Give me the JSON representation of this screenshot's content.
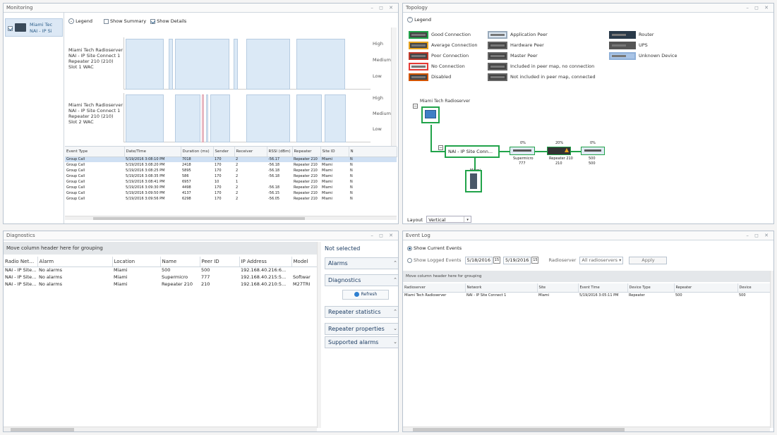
{
  "colors": {
    "accent": "#2d5f8a",
    "good": "#21a34a",
    "average": "#e7a21e",
    "poor": "#c0392b",
    "none": "#e53935",
    "disabled": "#d35400",
    "bar": "#dbe9f6"
  },
  "monitoring": {
    "title": "Monitoring",
    "device": {
      "name": "Miami Tec",
      "sub": "NAI - IP Si"
    },
    "legend": "Legend",
    "show_summary": "Show Summary",
    "show_details": "Show Details",
    "chart1": {
      "l1": "Miami Tech Radioserver",
      "l2": "NAI - IP Site Connect 1",
      "l3": "Repeater 210 (210)",
      "l4": "Slot 1 WAC"
    },
    "chart2": {
      "l1": "Miami Tech Radioserver",
      "l2": "NAI - IP Site Connect 1",
      "l3": "Repeater 210 (210)",
      "l4": "Slot 2 WAC"
    },
    "levels": [
      "High",
      "Medium",
      "Low"
    ],
    "table": {
      "headers": [
        "Event Type",
        "Date/Time",
        "Duration (ms)",
        "Sender",
        "Receiver",
        "RSSI (dBm)",
        "Repeater",
        "Site ID",
        "N"
      ],
      "rows": [
        [
          "Group Call",
          "5/19/2016 3:08:10 PM",
          "7018",
          "170",
          "2",
          "-56.17",
          "Repeater 210",
          "Miami",
          "N"
        ],
        [
          "Group Call",
          "5/19/2016 3:08:20 PM",
          "2418",
          "170",
          "2",
          "-56.18",
          "Repeater 210",
          "Miami",
          "N"
        ],
        [
          "Group Call",
          "5/19/2016 3:08:25 PM",
          "5895",
          "170",
          "2",
          "-56.18",
          "Repeater 210",
          "Miami",
          "N"
        ],
        [
          "Group Call",
          "5/19/2016 3:08:35 PM",
          "586",
          "170",
          "2",
          "-56.18",
          "Repeater 210",
          "Miami",
          "N"
        ],
        [
          "Group Call",
          "5/19/2016 3:08:41 PM",
          "6957",
          "10",
          "1",
          "",
          "Repeater 210",
          "Miami",
          "N"
        ],
        [
          "Group Call",
          "5/19/2016 3:09:30 PM",
          "4498",
          "170",
          "2",
          "-56.18",
          "Repeater 210",
          "Miami",
          "N"
        ],
        [
          "Group Call",
          "5/19/2016 3:09:50 PM",
          "4137",
          "170",
          "2",
          "-56.15",
          "Repeater 210",
          "Miami",
          "N"
        ],
        [
          "Group Call",
          "5/19/2016 3:09:56 PM",
          "6298",
          "170",
          "2",
          "-56.05",
          "Repeater 210",
          "Miami",
          "N"
        ]
      ]
    }
  },
  "topology": {
    "title": "Topology",
    "legend": "Legend",
    "legend_items": [
      "Good Connection",
      "Average Connection",
      "Poor Connection",
      "No Connection",
      "Disabled",
      "Application Peer",
      "Hardware Peer",
      "Master Peer",
      "Included in peer map, no connection",
      "Not included in peer map, connected",
      "Router",
      "UPS",
      "Unknown Device"
    ],
    "root": "Miami Tech Radioserver",
    "network": "NAI - IP Site Conn...",
    "site": "Miami",
    "peers": [
      {
        "pct": "0%",
        "name": "Supermicro",
        "id": "777"
      },
      {
        "pct": "20%",
        "name": "Repeater 210",
        "id": "210"
      },
      {
        "pct": "0%",
        "name": "500",
        "id": "500"
      }
    ],
    "layout_label": "Layout",
    "layout_value": "Vertical"
  },
  "diagnostics": {
    "title": "Diagnostics",
    "group_hint": "Move column header here for grouping",
    "headers": [
      "Radio Netwo...",
      "Alarm",
      "Location",
      "Name",
      "Peer ID",
      "IP Address",
      "Model"
    ],
    "rows": [
      [
        "NAI - IP Site C...",
        "No alarms",
        "Miami",
        "500",
        "500",
        "192.168.40.216:6...",
        ""
      ],
      [
        "NAI - IP Site C...",
        "No alarms",
        "Miami",
        "Supermicro",
        "777",
        "192.168.40.215:5...",
        "Softwar"
      ],
      [
        "NAI - IP Site C...",
        "No alarms",
        "Miami",
        "Repeater 210",
        "210",
        "192.168.40.210:5...",
        "M27TRI"
      ]
    ],
    "side": {
      "status": "Not selected",
      "alarms": "Alarms",
      "diagnostics": "Diagnostics",
      "refresh": "Refresh",
      "repeater_stats": "Repeater statistics",
      "repeater_props": "Repeater properties",
      "supported_alarms": "Supported alarms"
    }
  },
  "eventlog": {
    "title": "Event Log",
    "show_current": "Show Current Events",
    "show_logged": "Show Logged Events",
    "date_from": "5/18/2016",
    "date_to": "5/19/2016",
    "radioserver_label": "Radioserver",
    "radioserver_value": "All radioservers",
    "apply": "Apply",
    "group_hint": "Move column header here for grouping",
    "headers": [
      "Radioserver",
      "Network",
      "Site",
      "Event Time",
      "Device Type",
      "Repeater",
      "Device"
    ],
    "rows": [
      [
        "Miami Tech Radioserver",
        "NAI - IP Site Connect 1",
        "Miami",
        "5/19/2016 3:05:11 PM",
        "Repeater",
        "500",
        "500"
      ]
    ]
  }
}
